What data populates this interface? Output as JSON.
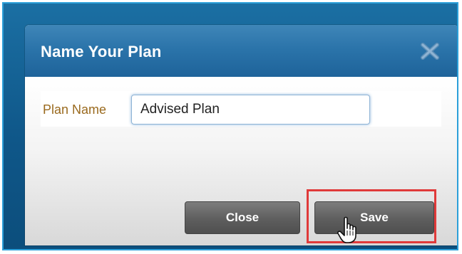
{
  "dialog": {
    "title": "Name Your Plan",
    "close_icon": "close-x-icon",
    "plan_name_label": "Plan Name",
    "plan_name_value": "Advised Plan",
    "close_button": "Close",
    "save_button": "Save"
  },
  "colors": {
    "title_bar": "#2b74aa",
    "label_text": "#9a6a1e",
    "button": "#5e5e5e",
    "highlight": "#e03a3a"
  },
  "cursor": "hand-pointer-icon"
}
